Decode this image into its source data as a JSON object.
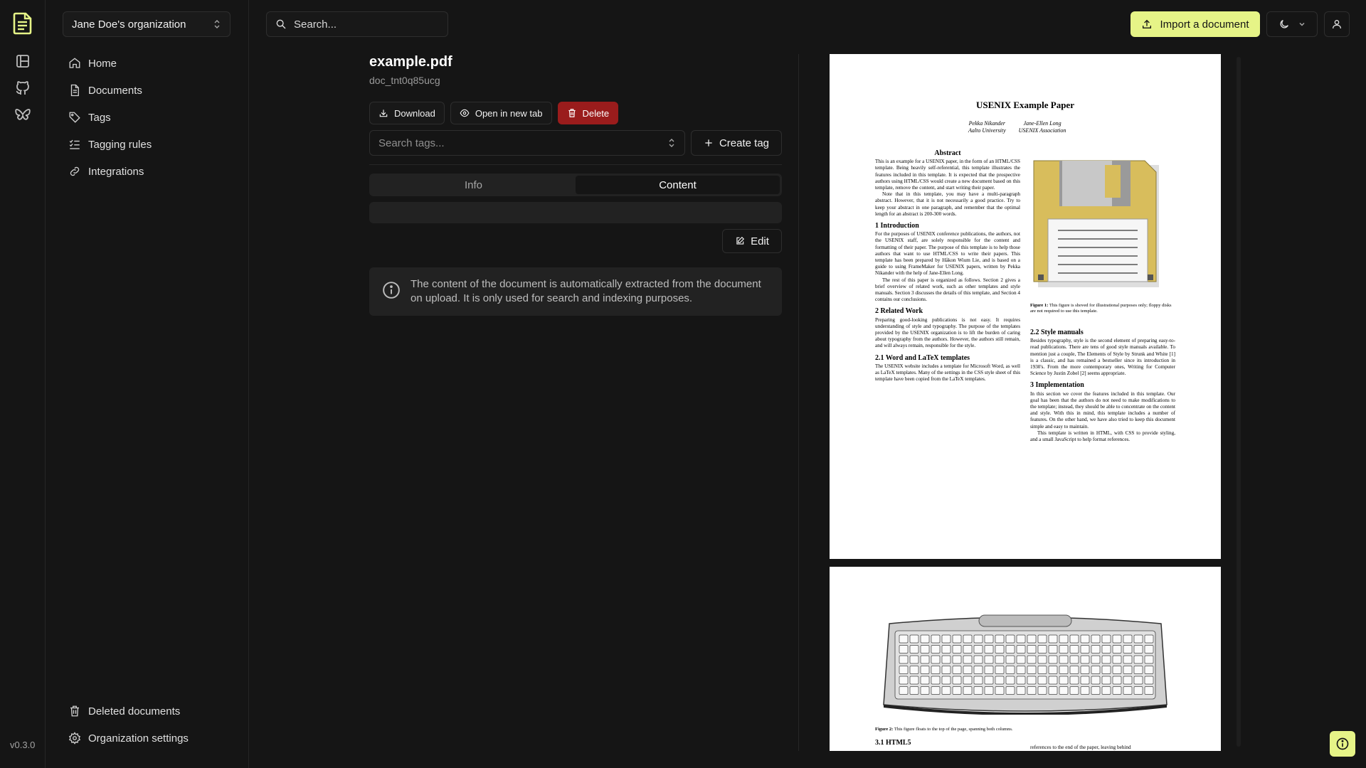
{
  "app": {
    "version": "v0.3.0"
  },
  "icons": {
    "logo": "papra-logo-icon",
    "rail": [
      "dashboard-icon",
      "github-icon",
      "bluesky-icon"
    ]
  },
  "sidebar": {
    "org_name": "Jane Doe's organization",
    "items": [
      {
        "label": "Home",
        "icon": "home-icon"
      },
      {
        "label": "Documents",
        "icon": "file-text-icon"
      },
      {
        "label": "Tags",
        "icon": "tag-icon"
      },
      {
        "label": "Tagging rules",
        "icon": "list-checks-icon"
      },
      {
        "label": "Integrations",
        "icon": "link-icon"
      }
    ],
    "bottom_items": [
      {
        "label": "Deleted documents",
        "icon": "trash-icon"
      },
      {
        "label": "Organization settings",
        "icon": "settings-icon"
      }
    ]
  },
  "topbar": {
    "search_label": "Search...",
    "import_label": "Import a document"
  },
  "document": {
    "name": "example.pdf",
    "id": "doc_tnt0q85ucg",
    "actions": {
      "download": "Download",
      "open_new_tab": "Open in new tab",
      "delete": "Delete"
    },
    "tags_placeholder": "Search tags...",
    "create_tag": "Create tag",
    "tabs": [
      {
        "label": "Info",
        "active": false
      },
      {
        "label": "Content",
        "active": true
      }
    ],
    "edit_label": "Edit",
    "info_text": "The content of the document is automatically extracted from the document on upload. It is only used for search and indexing purposes."
  },
  "colors": {
    "accent": "#e6f487",
    "danger": "#9a1c1c",
    "background": "#151515"
  },
  "preview": {
    "page1": {
      "title": "USENIX Example Paper",
      "author1_name": "Pekka Nikander",
      "author1_aff": "Aalto University",
      "author2_name": "Jane-Ellen Long",
      "author2_aff": "USENIX Association",
      "abstract_heading": "Abstract",
      "abstract_p1": "This is an example for a USENIX paper, in the form of an HTML/CSS template. Being heavily self-referential, this template illustrates the features included in this template. It is expected that the prospective authors using HTML/CSS would create a new document based on this template, remove the content, and start writing their paper.",
      "abstract_p2": "Note that in this template, you may have a multi-paragraph abstract. However, that it is not necessarily a good practice. Try to keep your abstract in one paragraph, and remember that the optimal length for an abstract is 200-300 words.",
      "intro_heading": "1 Introduction",
      "intro_p1": "For the purposes of USENIX conference publications, the authors, not the USENIX staff, are solely responsible for the content and formatting of their paper. The purpose of this template is to help those authors that want to use HTML/CSS to write their papers. This template has been prepared by Håkon Wium Lie, and is based on a guide to using FrameMaker for USENIX papers, written by Pekka Nikander with the help of Jane-Ellen Long.",
      "intro_p2": "The rest of this paper is organized as follows. Section 2 gives a brief overview of related work, such as other templates and style manuals. Section 3 discusses the details of this template, and Section 4 contains our conclusions.",
      "related_heading": "2 Related Work",
      "related_p1": "Preparing good-looking publications is not easy. It requires understanding of style and typography. The purpose of the templates provided by the USENIX organization is to lift the burden of caring about typography from the authors. However, the authors still remain, and will always remain, responsible for the style.",
      "word_heading": "2.1 Word and LaTeX templates",
      "word_p1": "The USENIX website includes a template for Microsoft Word, as well as LaTeX templates. Many of the settings in the CSS style sheet of this template have been copied from the LaTeX templates.",
      "fig1_caption_bold": "Figure 1:",
      "fig1_caption": "This figure is shoved for illustrational purposes only; floppy disks are not required to use this template.",
      "style_heading": "2.2 Style manuals",
      "style_p1": "Besides typography, style is the second element of preparing easy-to-read publications. There are tens of good style manuals available. To mention just a couple, The Elements of Style by Strunk and White [1] is a classic, and has remained a bestseller since its introduction in 1930's. From the more contemporary ones, Writing for Computer Science by Justin Zobel [2] seems appropriate.",
      "impl_heading": "3 Implementation",
      "impl_p1": "In this section we cover the features included in this template. Our goal has been that the authors do not need to make modifications to the template; instead, they should be able to concentrate on the content and style. With this in mind, this template includes a number of features. On the other hand, we have also tried to keep this document simple and easy to maintain.",
      "impl_p2": "This template is written in HTML, with CSS to provide styling, and a small JavaScript to help format references."
    },
    "page2": {
      "fig2_caption_bold": "Figure 2:",
      "fig2_caption": "This figure floats to the top of the page, spanning both columns.",
      "html5_heading": "3.1 HTML5",
      "trailing_text": "references to the end of the paper, leaving behind"
    }
  }
}
